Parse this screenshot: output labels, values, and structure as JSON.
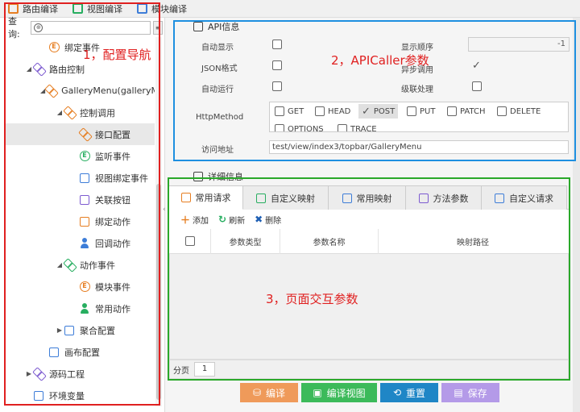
{
  "toolbar": {
    "items": [
      {
        "label": "路由编译",
        "color": "#e67e22"
      },
      {
        "label": "视图编译",
        "color": "#27ae60"
      },
      {
        "label": "模块编译",
        "color": "#3d7dd8"
      }
    ]
  },
  "search": {
    "label": "查询:"
  },
  "tree": {
    "items": [
      {
        "label": "绑定事件",
        "icon": "event-circle-icon",
        "color": "#e67e22"
      },
      {
        "label": "路由控制",
        "icon": "link-icon",
        "color": "#7d5bd0"
      },
      {
        "label": "GalleryMenu(galleryM",
        "icon": "link-icon",
        "color": "#e67e22"
      },
      {
        "label": "控制调用",
        "icon": "link-icon",
        "color": "#e67e22"
      },
      {
        "label": "接口配置",
        "icon": "link-icon",
        "color": "#e67e22"
      },
      {
        "label": "监听事件",
        "icon": "event-circle-icon",
        "color": "#27ae60"
      },
      {
        "label": "视图绑定事件",
        "icon": "hierarchy-icon",
        "color": "#3d7dd8"
      },
      {
        "label": "关联按钮",
        "icon": "doc-icon",
        "color": "#7d5bd0"
      },
      {
        "label": "绑定动作",
        "icon": "doc-icon",
        "color": "#e67e22"
      },
      {
        "label": "回调动作",
        "icon": "person-icon",
        "color": "#3d7dd8"
      },
      {
        "label": "动作事件",
        "icon": "key-icon",
        "color": "#27ae60"
      },
      {
        "label": "模块事件",
        "icon": "event-circle-icon",
        "color": "#e67e22"
      },
      {
        "label": "常用动作",
        "icon": "person-icon",
        "color": "#27ae60"
      },
      {
        "label": "聚合配置",
        "icon": "doc-icon",
        "color": "#3d7dd8"
      },
      {
        "label": "画布配置",
        "icon": "doc-icon",
        "color": "#3d7dd8"
      },
      {
        "label": "源码工程",
        "icon": "link-icon",
        "color": "#7d5bd0"
      },
      {
        "label": "环境变量",
        "icon": "doc-icon",
        "color": "#3d7dd8"
      }
    ]
  },
  "annotations": {
    "nav": "1，配置导航",
    "api": "2，APICaller参数",
    "page": "3，页面交互参数"
  },
  "api_section": {
    "title": "API信息",
    "auto_show_label": "自动显示",
    "json_label": "JSON格式",
    "auto_run_label": "自动运行",
    "order_label": "显示顺序",
    "order_value": "-1",
    "async_label": "异步调用",
    "cascade_label": "级联处理",
    "method_label": "HttpMethod",
    "methods": [
      "GET",
      "HEAD",
      "POST",
      "PUT",
      "PATCH",
      "DELETE",
      "OPTIONS",
      "TRACE"
    ],
    "selected_method": "POST",
    "url_label": "访问地址",
    "url_value": "test/view/index3/topbar/GalleryMenu"
  },
  "detail_section": {
    "title": "详细信息",
    "tabs": [
      {
        "label": "常用请求",
        "color": "#e67e22"
      },
      {
        "label": "自定义映射",
        "color": "#27ae60"
      },
      {
        "label": "常用映射",
        "color": "#3d7dd8"
      },
      {
        "label": "方法参数",
        "color": "#7d5bd0"
      },
      {
        "label": "自定义请求",
        "color": "#3d7dd8"
      }
    ],
    "grid_buttons": {
      "add": "添加",
      "refresh": "刷新",
      "delete": "删除"
    },
    "columns": [
      "参数类型",
      "参数名称",
      "映射路径"
    ],
    "pager_label": "分页",
    "page_number": "1"
  },
  "actions": [
    {
      "label": "编译",
      "color": "#ef9a5a"
    },
    {
      "label": "编译视图",
      "color": "#3cba5a"
    },
    {
      "label": "重置",
      "color": "#1f86c6"
    },
    {
      "label": "保存",
      "color": "#b49ae8"
    }
  ]
}
